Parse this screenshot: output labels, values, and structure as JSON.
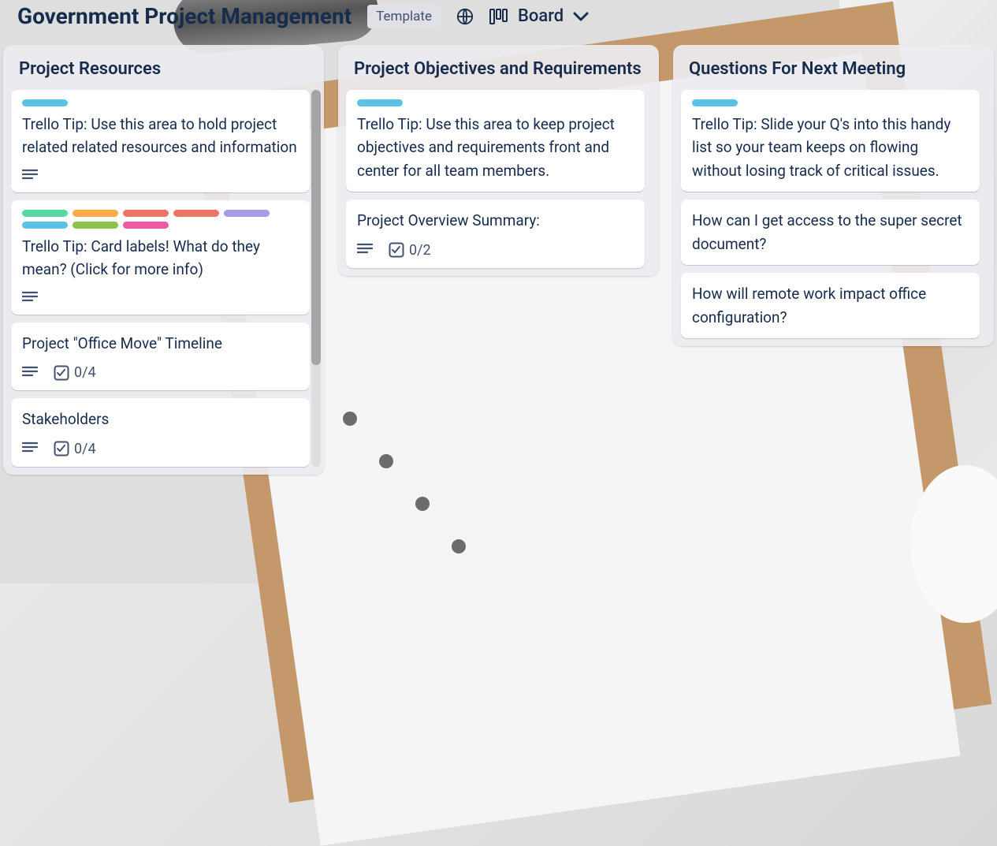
{
  "header": {
    "title": "Government Project Management",
    "template_label": "Template",
    "view_label": "Board"
  },
  "lists": [
    {
      "title": "Project Resources",
      "cards": [
        {
          "labels": [
            "sky"
          ],
          "text": "Trello Tip: Use this area to hold project related related resources and information",
          "has_desc": true
        },
        {
          "labels": [
            "green",
            "orange",
            "red",
            "red2",
            "purple",
            "sky",
            "lime",
            "pink"
          ],
          "text": "Trello Tip: Card labels! What do they mean? (Click for more info)",
          "has_desc": true
        },
        {
          "labels": [],
          "text": "Project \"Office Move\" Timeline",
          "has_desc": true,
          "checklist": "0/4"
        },
        {
          "labels": [],
          "text": "Stakeholders",
          "has_desc": true,
          "checklist": "0/4"
        }
      ]
    },
    {
      "title": "Project Objectives and Requirements",
      "cards": [
        {
          "labels": [
            "sky"
          ],
          "text": "Trello Tip: Use this area to keep project objectives and requirements front and center for all team members.",
          "has_desc": false
        },
        {
          "labels": [],
          "text": "Project Overview Summary:",
          "has_desc": true,
          "checklist": "0/2"
        }
      ]
    },
    {
      "title": "Questions For Next Meeting",
      "cards": [
        {
          "labels": [
            "sky"
          ],
          "text": "Trello Tip: Slide your Q's into this handy list so your team keeps on flowing without losing track of critical issues.",
          "has_desc": false
        },
        {
          "labels": [],
          "text": "How can I get access to the super secret document?",
          "has_desc": false
        },
        {
          "labels": [],
          "text": "How will remote work impact office configuration?",
          "has_desc": false
        }
      ]
    }
  ],
  "label_colors": {
    "sky": "c-sky",
    "green": "c-green",
    "orange": "c-orange",
    "red": "c-red",
    "red2": "c-red2",
    "purple": "c-purple",
    "lime": "c-lime",
    "pink": "c-pink"
  }
}
